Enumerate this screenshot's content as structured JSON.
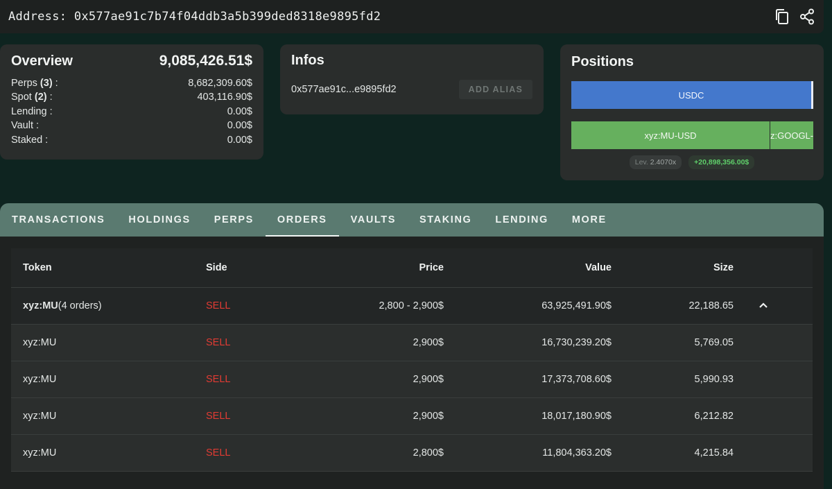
{
  "address_bar": {
    "label": "Address: 0x577ae91c7b74f04ddb3a5b399ded8318e9895fd2"
  },
  "overview": {
    "title": "Overview",
    "total": "9,085,426.51$",
    "rows": [
      {
        "label": "Perps",
        "count": "(3)",
        "suffix": " :",
        "value": "8,682,309.60$"
      },
      {
        "label": "Spot",
        "count": "(2)",
        "suffix": " :",
        "value": "403,116.90$"
      },
      {
        "label": "Lending :",
        "value": "0.00$"
      },
      {
        "label": "Vault :",
        "value": "0.00$"
      },
      {
        "label": "Staked :",
        "value": "0.00$"
      }
    ]
  },
  "infos": {
    "title": "Infos",
    "short_address": "0x577ae91c...e9895fd2",
    "add_alias_label": "ADD ALIAS"
  },
  "positions": {
    "title": "Positions",
    "usdc_label": "USDC",
    "mu_label": "xyz:MU-USD",
    "googl_label": "z:GOOGL-U",
    "lev_label": "Lev.",
    "lev_value": "2.4070x",
    "pnl": "+20,898,356.00$",
    "colors": {
      "usdc": "#4478cc",
      "perp": "#66b05e",
      "pnl": "#5fcf6a"
    }
  },
  "tabs": [
    {
      "label": "TRANSACTIONS"
    },
    {
      "label": "HOLDINGS"
    },
    {
      "label": "PERPS"
    },
    {
      "label": "ORDERS",
      "active": true
    },
    {
      "label": "VAULTS"
    },
    {
      "label": "STAKING"
    },
    {
      "label": "LENDING"
    },
    {
      "label": "MORE"
    }
  ],
  "orders_table": {
    "headers": {
      "token": "Token",
      "side": "Side",
      "price": "Price",
      "value": "Value",
      "size": "Size"
    },
    "group": {
      "token": "xyz:MU",
      "orders_note": "(4 orders)",
      "side": "SELL",
      "price": "2,800 - 2,900$",
      "value": "63,925,491.90$",
      "size": "22,188.65"
    },
    "rows": [
      {
        "token": "xyz:MU",
        "side": "SELL",
        "price": "2,900$",
        "value": "16,730,239.20$",
        "size": "5,769.05"
      },
      {
        "token": "xyz:MU",
        "side": "SELL",
        "price": "2,900$",
        "value": "17,373,708.60$",
        "size": "5,990.93"
      },
      {
        "token": "xyz:MU",
        "side": "SELL",
        "price": "2,900$",
        "value": "18,017,180.90$",
        "size": "6,212.82"
      },
      {
        "token": "xyz:MU",
        "side": "SELL",
        "price": "2,800$",
        "value": "11,804,363.20$",
        "size": "4,215.84"
      }
    ],
    "sell_color": "#e23b33"
  },
  "icons": {
    "copy": "copy-icon",
    "share": "share-icon",
    "collapse": "chevron-up-icon"
  }
}
